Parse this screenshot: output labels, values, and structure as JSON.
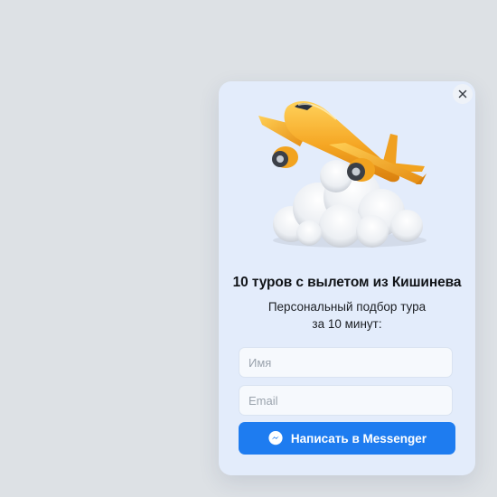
{
  "popup": {
    "title": "10 туров с вылетом из Кишинева",
    "subtitle_line1": "Персональный подбор тура",
    "subtitle_line2": "за 10 минут:",
    "name_placeholder": "Имя",
    "email_placeholder": "Email",
    "button_label": "Написать в Messenger",
    "close_icon": "close-icon",
    "button_icon": "messenger-icon",
    "illustration": "airplane-over-cloud-illustration"
  },
  "colors": {
    "page_background": "#dde1e5",
    "card_background": "#e3ecfb",
    "button_background": "#1e7cf0",
    "plane_body": "#f5a623"
  }
}
